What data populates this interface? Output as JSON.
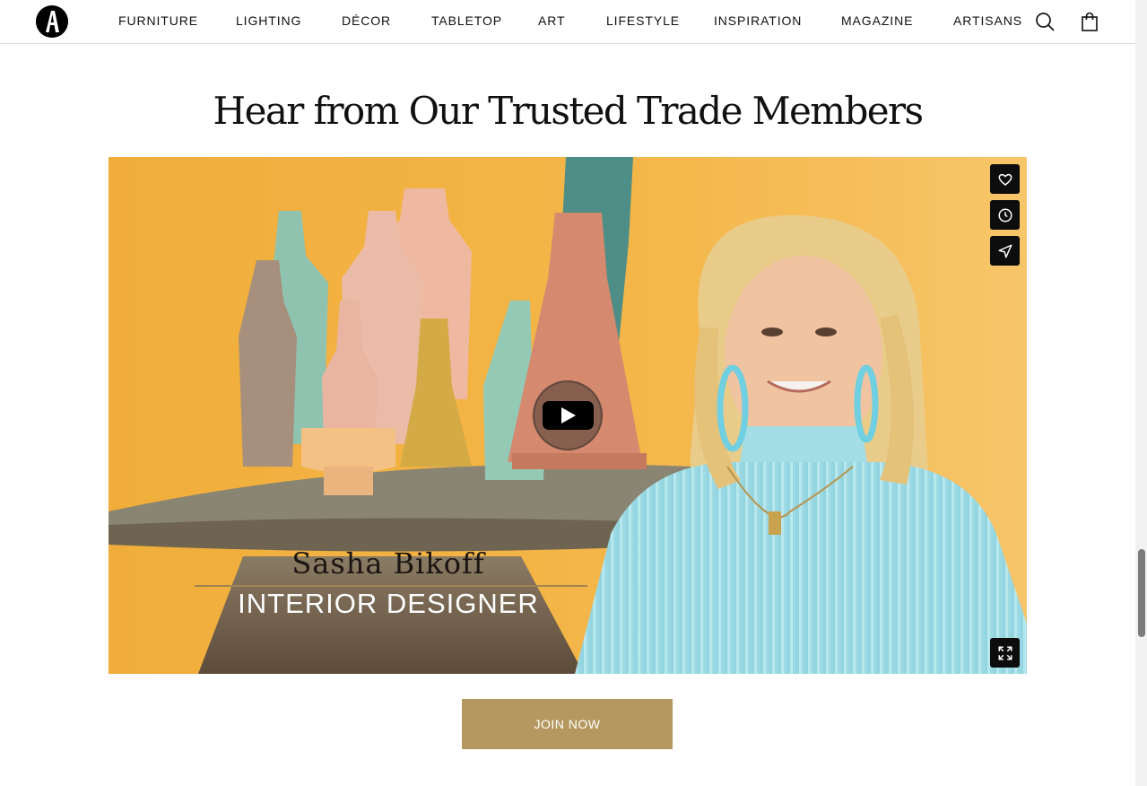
{
  "header": {
    "logo_icon": "brand-logo-icon",
    "nav": [
      {
        "label": "FURNITURE"
      },
      {
        "label": "LIGHTING"
      },
      {
        "label": "DÉCOR"
      },
      {
        "label": "TABLETOP"
      },
      {
        "label": "ART"
      },
      {
        "label": "LIFESTYLE"
      },
      {
        "label": "INSPIRATION"
      },
      {
        "label": "MAGAZINE"
      },
      {
        "label": "ARTISANS"
      }
    ],
    "icons": [
      "search-icon",
      "shopping-bag-icon"
    ]
  },
  "section": {
    "title": "Hear from Our Trusted Trade Members"
  },
  "video": {
    "caption_name": "Sasha Bikoff",
    "caption_role": "INTERIOR DESIGNER",
    "side_actions": [
      "heart-icon",
      "clock-icon",
      "send-icon"
    ],
    "play_icon": "play-icon",
    "fullscreen_icon": "fullscreen-icon",
    "background_color": "#f2b23f"
  },
  "cta": {
    "join_label": "JOIN NOW",
    "color": "#b5985f"
  }
}
